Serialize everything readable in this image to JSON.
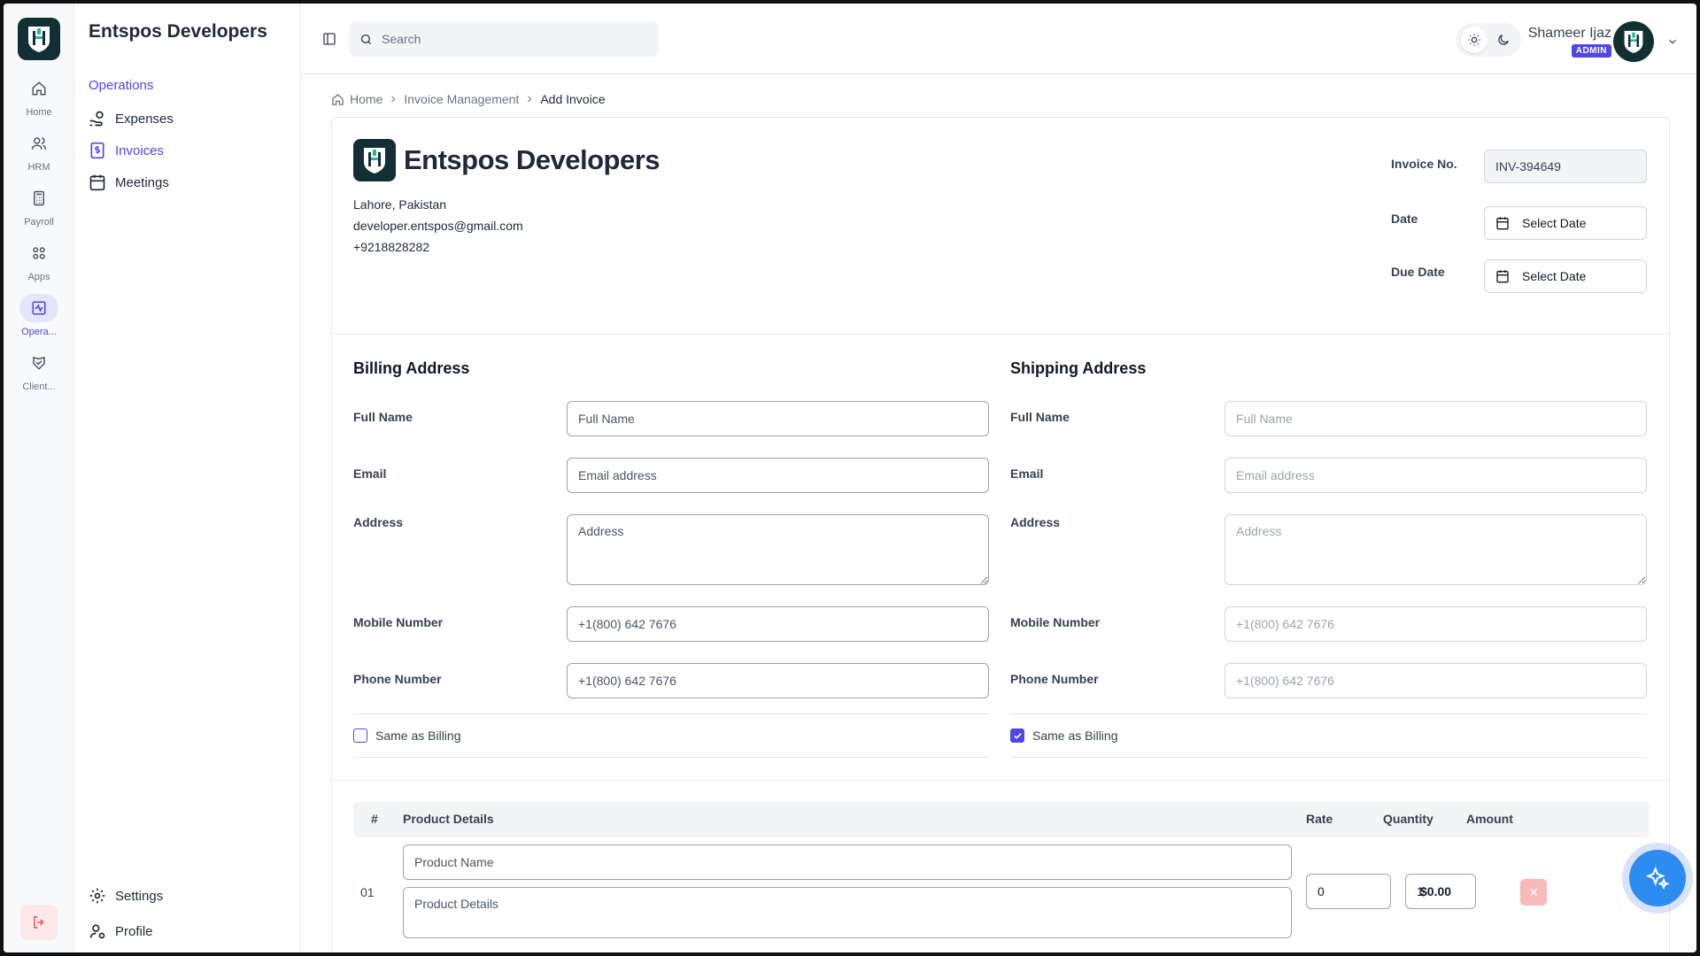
{
  "rail": {
    "items": [
      {
        "label": "Home"
      },
      {
        "label": "HRM"
      },
      {
        "label": "Payroll"
      },
      {
        "label": "Apps"
      },
      {
        "label": "Opera..."
      },
      {
        "label": "Client..."
      }
    ]
  },
  "subnav": {
    "brand": "Entspos Developers",
    "section": "Operations",
    "items": [
      {
        "label": "Expenses"
      },
      {
        "label": "Invoices"
      },
      {
        "label": "Meetings"
      }
    ],
    "settings": "Settings",
    "profile": "Profile"
  },
  "topbar": {
    "search_placeholder": "Search",
    "user_name": "Shameer Ijaz",
    "role": "ADMIN"
  },
  "breadcrumb": {
    "home": "Home",
    "parent": "Invoice Management",
    "current": "Add Invoice"
  },
  "company": {
    "name": "Entspos Developers",
    "location": "Lahore, Pakistan",
    "email": "developer.entspos@gmail.com",
    "phone": "+9218828282"
  },
  "invoice_meta": {
    "number_label": "Invoice No.",
    "number_value": "INV-394649",
    "date_label": "Date",
    "date_value": "Select Date",
    "due_label": "Due Date",
    "due_value": "Select Date"
  },
  "billing": {
    "title": "Billing Address",
    "full_name_label": "Full Name",
    "full_name_placeholder": "Full Name",
    "email_label": "Email",
    "email_placeholder": "Email address",
    "address_label": "Address",
    "address_placeholder": "Address",
    "mobile_label": "Mobile Number",
    "mobile_placeholder": "+1(800) 642 7676",
    "phone_label": "Phone Number",
    "phone_placeholder": "+1(800) 642 7676",
    "same_label": "Same as Billing",
    "same_checked": false
  },
  "shipping": {
    "title": "Shipping Address",
    "full_name_label": "Full Name",
    "full_name_placeholder": "Full Name",
    "email_label": "Email",
    "email_placeholder": "Email address",
    "address_label": "Address",
    "address_placeholder": "Address",
    "mobile_label": "Mobile Number",
    "mobile_placeholder": "+1(800) 642 7676",
    "phone_label": "Phone Number",
    "phone_placeholder": "+1(800) 642 7676",
    "same_label": "Same as Billing",
    "same_checked": true
  },
  "products": {
    "headers": {
      "num": "#",
      "details": "Product Details",
      "rate": "Rate",
      "quantity": "Quantity",
      "amount": "Amount"
    },
    "rows": [
      {
        "num": "01",
        "name_placeholder": "Product Name",
        "details_placeholder": "Product Details",
        "rate": "0",
        "quantity": "1",
        "amount": "$0.00"
      }
    ]
  },
  "colors": {
    "accent": "#4f46e5",
    "brand_dark": "#123034",
    "brand_teal": "#2bb3a3",
    "danger_soft": "#f8b9b9",
    "fab": "#2d8cf0"
  }
}
